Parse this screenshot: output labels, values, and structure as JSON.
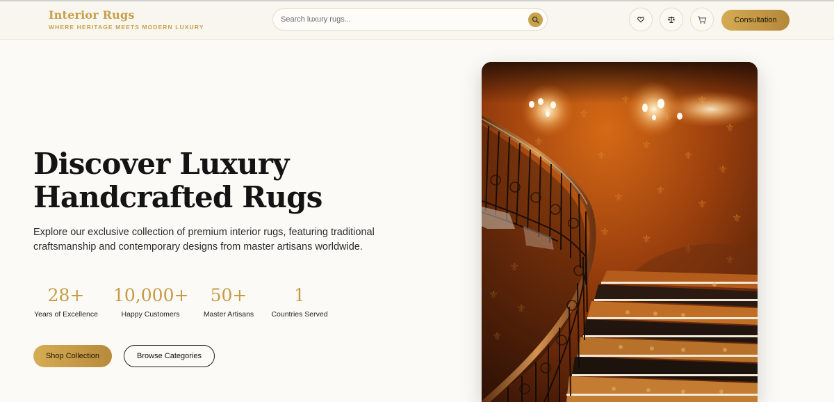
{
  "brand": {
    "name": "Interior Rugs",
    "tagline": "WHERE HERITAGE MEETS MODERN LUXURY"
  },
  "search": {
    "placeholder": "Search luxury rugs...",
    "icon": "search-icon"
  },
  "header_actions": {
    "wishlist_icon": "heart-icon",
    "compare_icon": "scale-icon",
    "cart_icon": "cart-icon",
    "consultation_label": "Consultation"
  },
  "hero": {
    "headline_line1": "Discover Luxury",
    "headline_line2": "Handcrafted Rugs",
    "description": "Explore our exclusive collection of premium interior rugs, featuring traditional craftsmanship and contemporary designs from master artisans worldwide.",
    "stats": [
      {
        "value": "28+",
        "label": "Years of Excellence"
      },
      {
        "value": "10,000+",
        "label": "Happy Customers"
      },
      {
        "value": "50+",
        "label": "Master Artisans"
      },
      {
        "value": "1",
        "label": "Countries Served"
      }
    ],
    "primary_cta": "Shop Collection",
    "secondary_cta": "Browse Categories"
  },
  "colors": {
    "accent_gold": "#c9a24a",
    "background": "#fbfaf6",
    "text_dark": "#141414"
  }
}
